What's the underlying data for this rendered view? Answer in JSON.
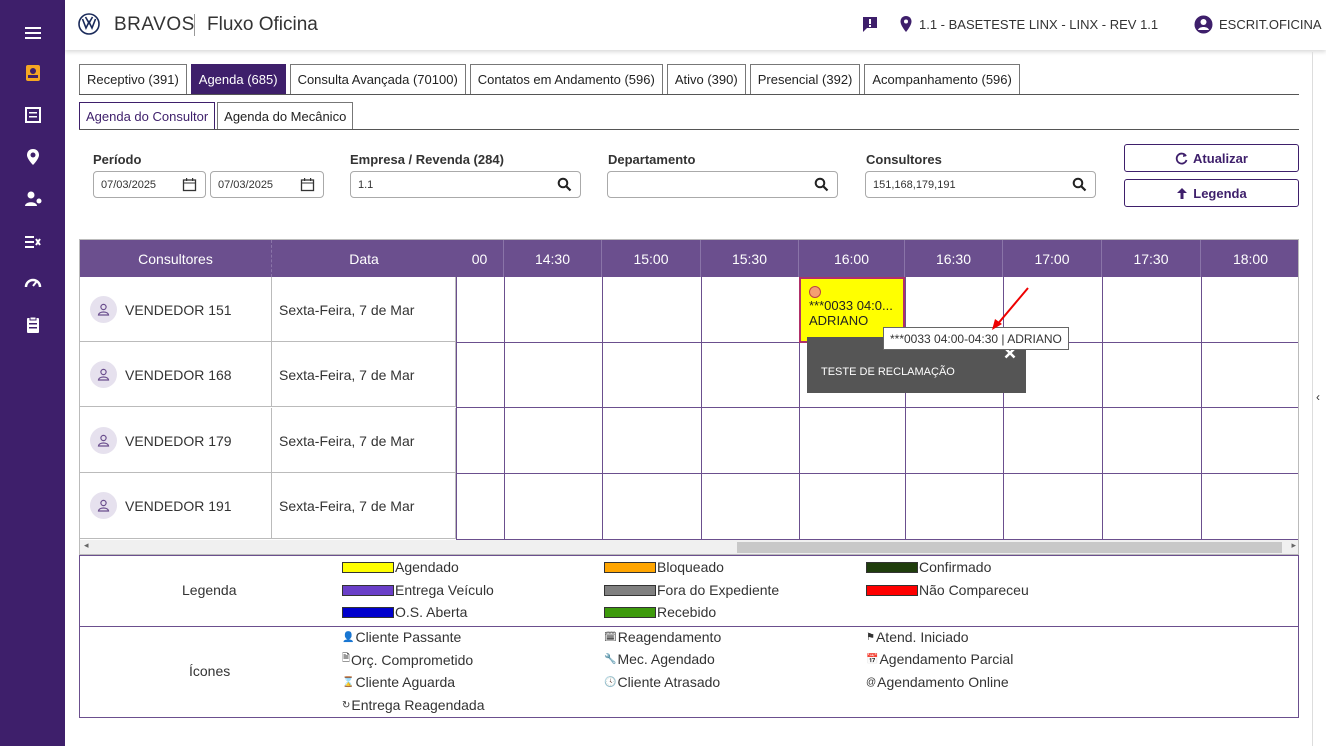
{
  "header": {
    "brand": "BRAVOS",
    "app_title": "Fluxo Oficina",
    "location": "1.1 - BASETESTE LINX - LINX - REV 1.1",
    "user": "ESCRIT.OFICINA"
  },
  "tabs": [
    {
      "label": "Receptivo (391)"
    },
    {
      "label": "Agenda (685)"
    },
    {
      "label": "Consulta Avançada (70100)"
    },
    {
      "label": "Contatos em Andamento (596)"
    },
    {
      "label": "Ativo (390)"
    },
    {
      "label": "Presencial (392)"
    },
    {
      "label": "Acompanhamento (596)"
    }
  ],
  "subtabs": [
    {
      "label": "Agenda do Consultor"
    },
    {
      "label": "Agenda do Mecânico"
    }
  ],
  "filters": {
    "periodo_label": "Período",
    "date_start": "07/03/2025",
    "date_end": "07/03/2025",
    "empresa_label": "Empresa / Revenda (284)",
    "empresa_value": "1.1",
    "departamento_label": "Departamento",
    "departamento_value": "",
    "consultores_label": "Consultores",
    "consultores_value": "151,168,179,191"
  },
  "buttons": {
    "atualizar": "Atualizar",
    "legenda": "Legenda"
  },
  "grid": {
    "col_consultores": "Consultores",
    "col_data": "Data",
    "times": [
      "00",
      "14:30",
      "15:00",
      "15:30",
      "16:00",
      "16:30",
      "17:00",
      "17:30",
      "18:00"
    ],
    "rows": [
      {
        "name": "VENDEDOR 151",
        "date": "Sexta-Feira, 7 de Mar"
      },
      {
        "name": "VENDEDOR 168",
        "date": "Sexta-Feira, 7 de Mar"
      },
      {
        "name": "VENDEDOR 179",
        "date": "Sexta-Feira, 7 de Mar"
      },
      {
        "name": "VENDEDOR 191",
        "date": "Sexta-Feira, 7 de Mar"
      }
    ],
    "event": {
      "line1": "***0033 04:0...",
      "line2": "ADRIANO",
      "color": "#ffff00"
    }
  },
  "tooltip": "***0033 04:00-04:30 | ADRIANO",
  "popup": {
    "text": "TESTE DE RECLAMAÇÃO"
  },
  "legend": {
    "title": "Legenda",
    "items": [
      {
        "label": "Agendado",
        "color": "#ffff00"
      },
      {
        "label": "Bloqueado",
        "color": "#ffa500"
      },
      {
        "label": "Confirmado",
        "color": "#1f3d0c"
      },
      {
        "label": "Entrega Veículo",
        "color": "#6a3fc8"
      },
      {
        "label": "Fora do Expediente",
        "color": "#808080"
      },
      {
        "label": "Não Compareceu",
        "color": "#ff0000"
      },
      {
        "label": "O.S. Aberta",
        "color": "#0000cc"
      },
      {
        "label": "Recebido",
        "color": "#3d9a0c"
      }
    ]
  },
  "icons_legend": {
    "title": "Ícones",
    "items": [
      {
        "label": "Cliente Passante",
        "glyph": "👤"
      },
      {
        "label": "Reagendamento",
        "glyph": "🗓"
      },
      {
        "label": "Atend. Iniciado",
        "glyph": "⚑"
      },
      {
        "label": "Orç. Comprometido",
        "glyph": "🗎"
      },
      {
        "label": "Mec. Agendado",
        "glyph": "🔧"
      },
      {
        "label": "Agendamento Parcial",
        "glyph": "📅"
      },
      {
        "label": "Cliente Aguarda",
        "glyph": "⌛"
      },
      {
        "label": "Cliente Atrasado",
        "glyph": "🕓"
      },
      {
        "label": "Agendamento Online",
        "glyph": "@"
      },
      {
        "label": "Entrega Reagendada",
        "glyph": "↻"
      }
    ]
  }
}
